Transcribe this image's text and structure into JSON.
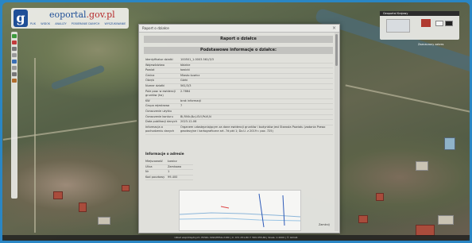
{
  "header": {
    "logo_letter": "g",
    "logo_text_1": "eoportal",
    "logo_text_2": ".gov.pl",
    "menu": [
      "PLIK",
      "WIDOK",
      "ANALIZY",
      "POBIERANIE DANYCH",
      "WYSZUKIWANIE"
    ]
  },
  "right_panel": {
    "title": "Geoportal Krajowy",
    "scale_text": "Zaznaczony zakres"
  },
  "dialog": {
    "title": "Raport o działce",
    "heading": "Raport o działce",
    "section_title": "Podstawowe informacje o działce:",
    "rows": [
      {
        "key": "Identyfikator działki",
        "value": "100501_1.0003.561/3/3"
      },
      {
        "key": "Województwo",
        "value": "łódzkie"
      },
      {
        "key": "Powiat",
        "value": "łowicki"
      },
      {
        "key": "Gmina",
        "value": "Miasto Łowicz"
      },
      {
        "key": "Obręb",
        "value": "Górki"
      },
      {
        "key": "Numer działki",
        "value": "561/3/3"
      },
      {
        "key": "Pole pow. w ewidencji gruntów (ha)",
        "value": "2.7664"
      },
      {
        "key": "KW",
        "value": "brak informacji"
      },
      {
        "key": "Grupa rejestrowa",
        "value": "7"
      },
      {
        "key": "Oznaczenie użytku",
        "value": ""
      },
      {
        "key": "Oznaczenie konturu",
        "value": "Bi,RIVb,Bz,LSVI,PsVI,N"
      },
      {
        "key": "Data publikacji danych",
        "value": "2023-12-06"
      },
      {
        "key": "Informacja o pochodzeniu danych",
        "value": "Organem udostępniającym za dane ewidencji gruntów i budynków jest Starosta Powiatu (zadania Prawo geodezyjne i kartograficzne art. 7d pkt 1; Dz.U. z 2019 r. poz. 725)"
      }
    ],
    "address_title": "Informacje o adresie",
    "address_rows": [
      {
        "key": "Miejscowość",
        "value": "Łowicz"
      },
      {
        "key": "Ulica",
        "value": "Zamkowa"
      },
      {
        "key": "Nr",
        "value": "1"
      },
      {
        "key": "Kod pocztowy",
        "value": "99-400"
      }
    ],
    "close_label": "Zamknij"
  },
  "bottom_bar": "Układ współrzędnych: PUWG 1992/EPSG:2180  |  X: 471 251,80  Y: 569 055,66  |  Skala: 1:2000  |  © GUGiK"
}
